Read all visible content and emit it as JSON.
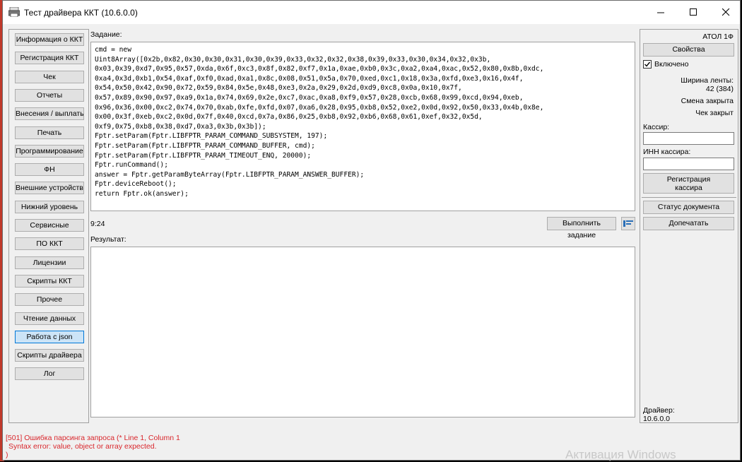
{
  "window": {
    "title": "Тест драйвера ККТ (10.6.0.0)"
  },
  "nav": {
    "items": [
      "Информация о ККТ",
      "Регистрация ККТ",
      "Чек",
      "Отчеты",
      "Внесения / выплаты",
      "Печать",
      "Программирование",
      "ФН",
      "Внешние устройства",
      "Нижний уровень",
      "Сервисные",
      "ПО ККТ",
      "Лицензии",
      "Скрипты ККТ",
      "Прочее",
      "Чтение данных",
      "Работа с json",
      "Скрипты драйвера",
      "Лог"
    ],
    "active_index": 16
  },
  "task": {
    "label": "Задание:",
    "code_lines": [
      "cmd = new",
      "Uint8Array([0x2b,0x82,0x30,0x30,0x31,0x30,0x39,0x33,0x32,0x32,0x38,0x39,0x33,0x30,0x34,0x32,0x3b,",
      "0x03,0x39,0xd7,0x95,0x57,0xda,0x6f,0xc3,0x8f,0x82,0xf7,0x1a,0xae,0xb0,0x3c,0xa2,0xa4,0xac,0x52,0x80,0x8b,0xdc,",
      "0xa4,0x3d,0xb1,0x54,0xaf,0xf0,0xad,0xa1,0x8c,0x08,0x51,0x5a,0x70,0xed,0xc1,0x18,0x3a,0xfd,0xe3,0x16,0x4f,",
      "0x54,0x50,0x42,0x90,0x72,0x59,0x84,0x5e,0x48,0xe3,0x2a,0x29,0x2d,0xd9,0xc8,0x0a,0x10,0x7f,",
      "0x57,0x89,0x90,0x97,0xa9,0x1a,0x74,0x69,0x2e,0xc7,0xac,0xa8,0xf9,0x57,0x28,0xcb,0x68,0x99,0xcd,0x94,0xeb,",
      "0x96,0x36,0x00,0xc2,0x74,0x70,0xab,0xfe,0xfd,0x07,0xa6,0x28,0x95,0xb8,0x52,0xe2,0x0d,0x92,0x50,0x33,0x4b,0x8e,",
      "0x00,0x3f,0xeb,0xc2,0x0d,0x7f,0x40,0xcd,0x7a,0x86,0x25,0xb8,0x92,0xb6,0x68,0x61,0xef,0x32,0x5d,",
      "0xf9,0x75,0xb8,0x38,0xd7,0xa3,0x3b,0x3b]);",
      "Fptr.setParam(Fptr.LIBFPTR_PARAM_COMMAND_SUBSYSTEM, 197);",
      "Fptr.setParam(Fptr.LIBFPTR_PARAM_COMMAND_BUFFER, cmd);",
      "Fptr.setParam(Fptr.LIBFPTR_PARAM_TIMEOUT_ENQ, 20000);",
      "Fptr.runCommand();",
      "answer = Fptr.getParamByteArray(Fptr.LIBFPTR_PARAM_ANSWER_BUFFER);",
      "Fptr.deviceReboot();",
      "return Fptr.ok(answer);"
    ],
    "cursor_pos": "9:24",
    "run_button": "Выполнить задание"
  },
  "result": {
    "label": "Результат:",
    "value": ""
  },
  "right": {
    "device": "АТОЛ 1Ф",
    "properties_button": "Свойства",
    "enabled_label": "Включено",
    "enabled": true,
    "tape_width_label": "Ширина ленты:",
    "tape_width_value": "42 (384)",
    "shift_status": "Смена закрыта",
    "receipt_status": "Чек закрыт",
    "cashier_label": "Кассир:",
    "cashier_value": "",
    "inn_label": "ИНН кассира:",
    "inn_value": "",
    "register_cashier_line1": "Регистрация",
    "register_cashier_line2": "кассира",
    "doc_status_button": "Статус документа",
    "reprint_button": "Допечатать",
    "driver_label": "Драйвер:",
    "driver_version": "10.6.0.0"
  },
  "error": {
    "line1": "[501] Ошибка парсинга запроса (* Line 1, Column 1",
    "line2": "Syntax error: value, object or array expected.",
    "line3": ")"
  },
  "watermark": "Активация Windows",
  "icons": {
    "app": "printer-icon",
    "align": "align-icon",
    "check": "checkmark-icon"
  }
}
